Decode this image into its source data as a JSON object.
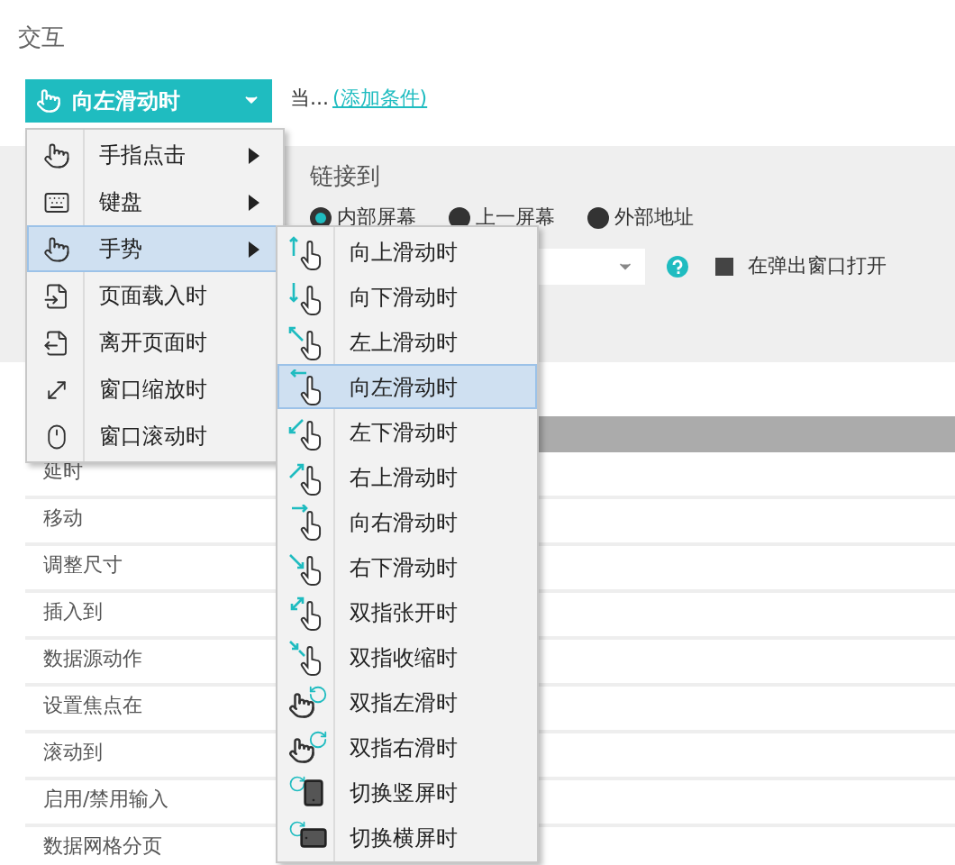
{
  "section_title": "交互",
  "event_button": {
    "label": "向左滑动时"
  },
  "condition": {
    "prefix": "当...",
    "link": "(添加条件)"
  },
  "link_panel": {
    "title": "链接到",
    "radios": [
      {
        "label": "内部屏幕",
        "selected": true
      },
      {
        "label": "上一屏幕",
        "selected": false
      },
      {
        "label": "外部地址",
        "selected": false
      }
    ],
    "popup_checkbox": {
      "label": "在弹出窗口打开",
      "checked": false
    }
  },
  "actions": [
    "延时",
    "移动",
    "调整尺寸",
    "插入到",
    "数据源动作",
    "设置焦点在",
    "滚动到",
    "启用/禁用输入",
    "数据网格分页"
  ],
  "menu": [
    {
      "label": "手指点击",
      "submenu": true,
      "selected": false
    },
    {
      "label": "键盘",
      "submenu": true,
      "selected": false
    },
    {
      "label": "手势",
      "submenu": true,
      "selected": true
    },
    {
      "label": "页面载入时",
      "submenu": false,
      "selected": false
    },
    {
      "label": "离开页面时",
      "submenu": false,
      "selected": false
    },
    {
      "label": "窗口缩放时",
      "submenu": false,
      "selected": false
    },
    {
      "label": "窗口滚动时",
      "submenu": false,
      "selected": false
    }
  ],
  "submenu": [
    {
      "label": "向上滑动时",
      "selected": false
    },
    {
      "label": "向下滑动时",
      "selected": false
    },
    {
      "label": "左上滑动时",
      "selected": false
    },
    {
      "label": "向左滑动时",
      "selected": true
    },
    {
      "label": "左下滑动时",
      "selected": false
    },
    {
      "label": "右上滑动时",
      "selected": false
    },
    {
      "label": "向右滑动时",
      "selected": false
    },
    {
      "label": "右下滑动时",
      "selected": false
    },
    {
      "label": "双指张开时",
      "selected": false
    },
    {
      "label": "双指收缩时",
      "selected": false
    },
    {
      "label": "双指左滑时",
      "selected": false
    },
    {
      "label": "双指右滑时",
      "selected": false
    },
    {
      "label": "切换竖屏时",
      "selected": false
    },
    {
      "label": "切换横屏时",
      "selected": false
    }
  ]
}
